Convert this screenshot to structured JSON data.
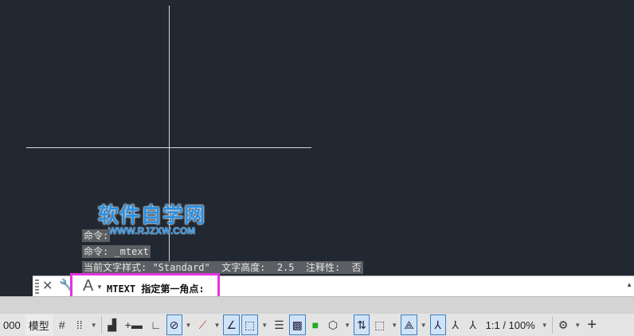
{
  "watermark": {
    "title": "软件自学网",
    "url": "WWW.RJZXW.COM"
  },
  "history": [
    "命令:",
    "命令: _mtext",
    "当前文字样式: \"Standard\"  文字高度:  2.5  注释性:  否"
  ],
  "command": {
    "icon": "text-A-icon",
    "prompt": "MTEXT 指定第一角点:"
  },
  "status": {
    "coords": "000",
    "model": "模型",
    "scale": "1:1 / 100%"
  },
  "colors": {
    "canvas": "#222831",
    "highlight": "#e532e0",
    "active": "#cfe3f7"
  }
}
